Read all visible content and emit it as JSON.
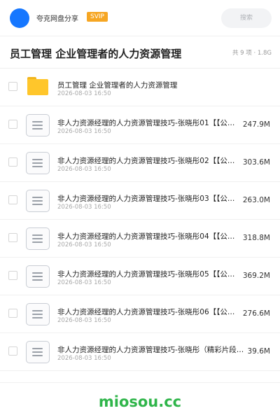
{
  "topbar": {
    "app_name": "夸克网盘分享",
    "badge": "SVIP",
    "search_placeholder": "搜索",
    "avatar_color": "#1677ff"
  },
  "header": {
    "title": "员工管理 企业管理者的人力资源管理",
    "meta": "共 9 项 · 1.8G"
  },
  "items": [
    {
      "type": "folder",
      "icon": "folder-icon",
      "name": "员工管理 企业管理者的人力资源管理",
      "date": "2026-08-03 16:50",
      "size": ""
    },
    {
      "type": "file",
      "icon": "document-icon",
      "name": "非人力资源经理的人力资源管理技巧-张晓彤01【【公…",
      "date": "2026-08-03 16:50",
      "size": "247.9M"
    },
    {
      "type": "file",
      "icon": "document-icon",
      "name": "非人力资源经理的人力资源管理技巧-张晓彤02【【公…",
      "date": "2026-08-03 16:50",
      "size": "303.6M"
    },
    {
      "type": "file",
      "icon": "document-icon",
      "name": "非人力资源经理的人力资源管理技巧-张晓彤03【【公…",
      "date": "2026-08-03 16:50",
      "size": "263.0M"
    },
    {
      "type": "file",
      "icon": "document-icon",
      "name": "非人力资源经理的人力资源管理技巧-张晓彤04【【公…",
      "date": "2026-08-03 16:50",
      "size": "318.8M"
    },
    {
      "type": "file",
      "icon": "document-icon",
      "name": "非人力资源经理的人力资源管理技巧-张晓彤05【【公…",
      "date": "2026-08-03 16:50",
      "size": "369.2M"
    },
    {
      "type": "file",
      "icon": "document-icon",
      "name": "非人力资源经理的人力资源管理技巧-张晓彤06【【公…",
      "date": "2026-08-03 16:50",
      "size": "276.6M"
    },
    {
      "type": "file",
      "icon": "document-icon",
      "name": "非人力资源经理的人力资源管理技巧-张晓彤（精彩片段…",
      "date": "2026-08-03 16:50",
      "size": "39.6M"
    }
  ],
  "watermark": "miosou.cc",
  "colors": {
    "badge": "#f6a623",
    "folder": "#ffc62b",
    "watermark": "#2fb54a"
  }
}
